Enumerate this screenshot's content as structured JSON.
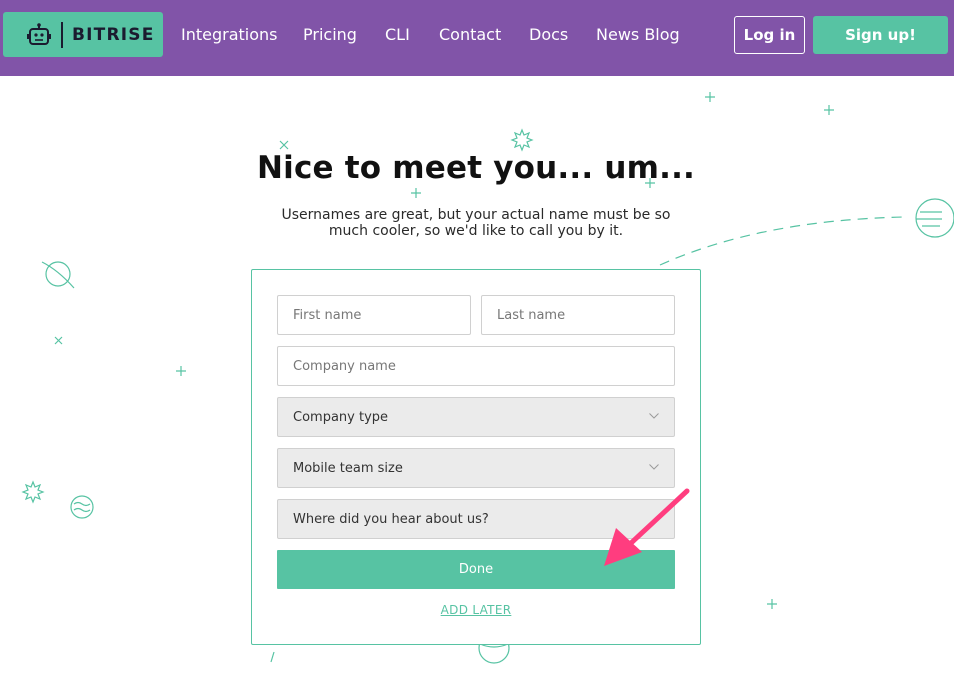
{
  "header": {
    "brand": "BITRISE",
    "nav": [
      "Integrations",
      "Pricing",
      "CLI",
      "Contact",
      "Docs",
      "News Blog"
    ],
    "login_label": "Log in",
    "signup_label": "Sign up!"
  },
  "main": {
    "title": "Nice to meet you... um...",
    "subtitle": "Usernames are great, but your actual name must be so much cooler, so we'd like to call you by it."
  },
  "form": {
    "first_name_placeholder": "First name",
    "last_name_placeholder": "Last name",
    "company_name_placeholder": "Company name",
    "company_type_label": "Company type",
    "team_size_label": "Mobile team size",
    "heard_about_label": "Where did you hear about us?",
    "done_label": "Done",
    "add_later_label": "ADD LATER"
  },
  "colors": {
    "header_bg": "#8154a8",
    "accent": "#57c3a3",
    "annotation_arrow": "#ff3d7f"
  }
}
